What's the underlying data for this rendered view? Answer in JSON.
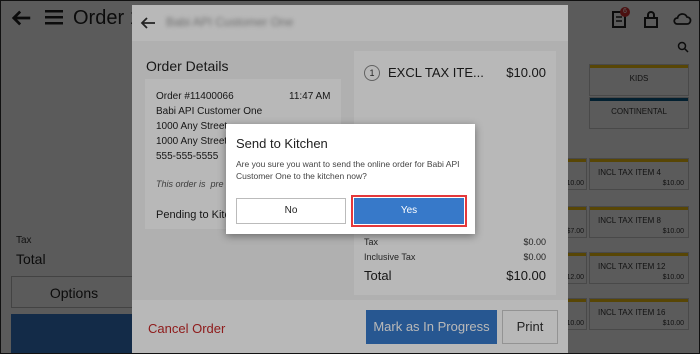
{
  "app": {
    "title": "Order 10",
    "notification_count": "6"
  },
  "bg_left": {
    "tax_label": "Tax",
    "total_label": "Total",
    "options_label": "Options"
  },
  "bg_right": {
    "tiles": [
      {
        "name": "KIDS",
        "stripe": "#f5c211"
      },
      {
        "name": "CONTINENTAL",
        "stripe": "#0a5a86"
      },
      {
        "name": "INCL TAX ITEM 4",
        "price": "$10.00"
      },
      {
        "name": "INCL TAX ITEM 8",
        "price": "$10.00"
      },
      {
        "name": "INCL TAX ITEM 12",
        "price": "$10.00"
      },
      {
        "name": "INCL TAX ITEM 16",
        "price": "$10.00"
      }
    ],
    "left_prices": [
      "$10.00",
      "$7.00",
      "$12.00",
      "$10.00"
    ]
  },
  "order_detail": {
    "customer_title": "Babi API Customer One",
    "heading": "Order Details",
    "order_number": "Order #11400066",
    "time": "11:47 AM",
    "customer": "Babi API Customer One",
    "address_1": "1000 Any Street",
    "address_2": "1000 Any Street",
    "phone": "555-555-5555",
    "note": "This order is",
    "note_tail": "pre",
    "status": "Pending to Kitch",
    "item": {
      "qty": "1",
      "name": "EXCL TAX ITE...",
      "price": "$10.00"
    },
    "tax_label": "Tax",
    "tax_value": "$0.00",
    "inclusive_tax_label": "Inclusive Tax",
    "inclusive_tax_value": "$0.00",
    "total_label": "Total",
    "total_value": "$10.00",
    "cancel_label": "Cancel Order",
    "mark_label": "Mark as In Progress",
    "print_label": "Print"
  },
  "dialog": {
    "title": "Send to Kitchen",
    "message": "Are you sure you want to send the online order for Babi API Customer One to the kitchen now?",
    "no_label": "No",
    "yes_label": "Yes"
  },
  "colors": {
    "primary": "#3779c9",
    "danger": "#c62828",
    "highlight": "#e5383b",
    "accent_yellow": "#f5c211"
  }
}
